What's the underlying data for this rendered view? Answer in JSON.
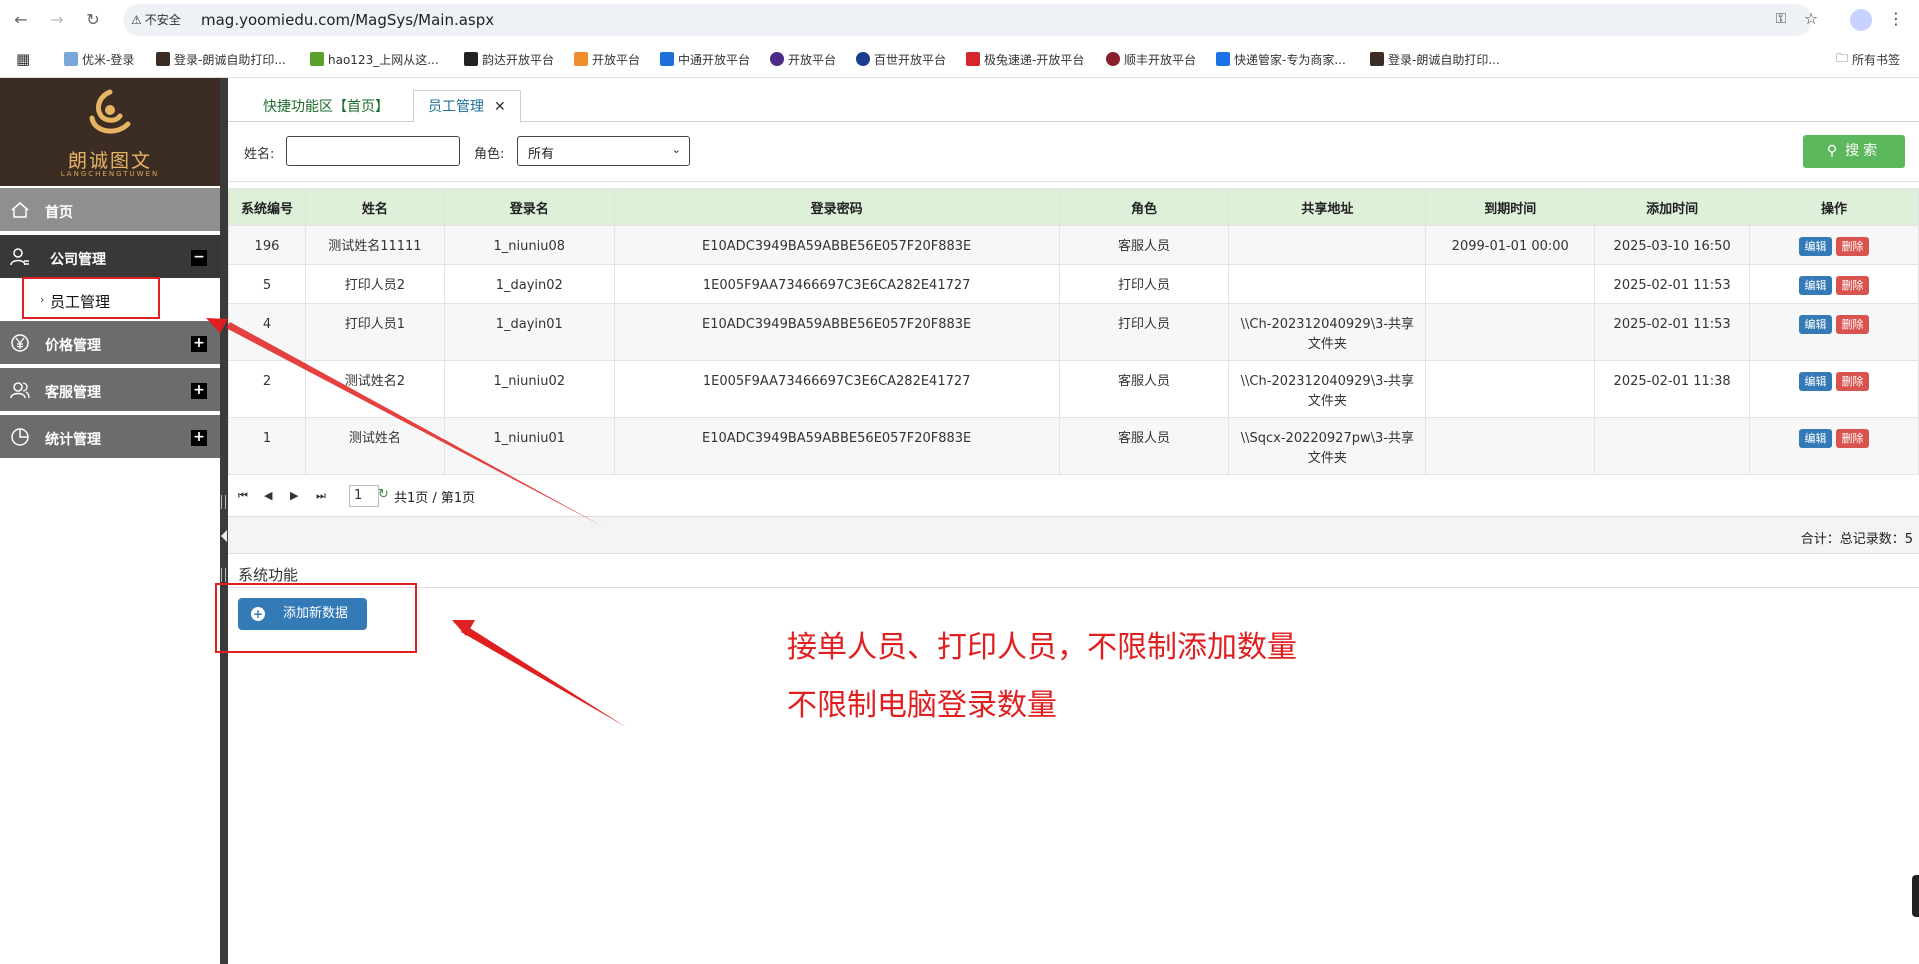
{
  "browser": {
    "security_label": "不安全",
    "url": "mag.yoomiedu.com/MagSys/Main.aspx"
  },
  "bookmarks": [
    {
      "label": "优米-登录",
      "color": "#7aa7d8"
    },
    {
      "label": "登录-朗诚自助打印...",
      "color": "#3b2d23"
    },
    {
      "label": "hao123_上网从这...",
      "color": "#5aa02c"
    },
    {
      "label": "韵达开放平台",
      "color": "#222222"
    },
    {
      "label": "开放平台",
      "color": "#f08c2a"
    },
    {
      "label": "中通开放平台",
      "color": "#1e6fd9"
    },
    {
      "label": "开放平台",
      "color": "#4b2a8a"
    },
    {
      "label": "百世开放平台",
      "color": "#1b3d8f"
    },
    {
      "label": "极兔速递-开放平台",
      "color": "#d6262c"
    },
    {
      "label": "顺丰开放平台",
      "color": "#8a1e2a"
    },
    {
      "label": "快递管家-专为商家...",
      "color": "#1a73e8"
    },
    {
      "label": "登录-朗诚自助打印...",
      "color": "#3b2d23"
    }
  ],
  "bookmarks_all": "所有书签",
  "logo": {
    "cn": "朗诚图文",
    "en": "LANGCHENGTUWEN"
  },
  "sidebar": {
    "home": "首页",
    "company": "公司管理",
    "company_toggle": "−",
    "sub_staff": "员工管理",
    "price": "价格管理",
    "service": "客服管理",
    "stats": "统计管理",
    "plus": "+"
  },
  "tabs": [
    {
      "label": "快捷功能区【首页】"
    },
    {
      "label": "员工管理",
      "close": "✕"
    }
  ],
  "search": {
    "name_label": "姓名:",
    "role_label": "角色:",
    "role_value": "所有",
    "button": "搜索"
  },
  "table": {
    "headers": [
      "系统编号",
      "姓名",
      "登录名",
      "登录密码",
      "角色",
      "共享地址",
      "到期时间",
      "添加时间",
      "操作"
    ],
    "rows": [
      {
        "id": "196",
        "name": "测试姓名11111",
        "login": "1_niuniu08",
        "pwd": "E10ADC3949BA59ABBE56E057F20F883E",
        "role": "客服人员",
        "share1": "",
        "share2": "",
        "expire": "2099-01-01 00:00",
        "added": "2025-03-10 16:50"
      },
      {
        "id": "5",
        "name": "打印人员2",
        "login": "1_dayin02",
        "pwd": "1E005F9AA73466697C3E6CA282E41727",
        "role": "打印人员",
        "share1": "",
        "share2": "",
        "expire": "",
        "added": "2025-02-01 11:53"
      },
      {
        "id": "4",
        "name": "打印人员1",
        "login": "1_dayin01",
        "pwd": "E10ADC3949BA59ABBE56E057F20F883E",
        "role": "打印人员",
        "share1": "\\\\Ch-202312040929\\3-共享",
        "share2": "文件夹",
        "expire": "",
        "added": "2025-02-01 11:53"
      },
      {
        "id": "2",
        "name": "测试姓名2",
        "login": "1_niuniu02",
        "pwd": "1E005F9AA73466697C3E6CA282E41727",
        "role": "客服人员",
        "share1": "\\\\Ch-202312040929\\3-共享",
        "share2": "文件夹",
        "expire": "",
        "added": "2025-02-01 11:38"
      },
      {
        "id": "1",
        "name": "测试姓名",
        "login": "1_niuniu01",
        "pwd": "E10ADC3949BA59ABBE56E057F20F883E",
        "role": "客服人员",
        "share1": "\\\\Sqcx-20220927pw\\3-共享",
        "share2": "文件夹",
        "expire": "",
        "added": ""
      }
    ],
    "edit_label": "编辑",
    "delete_label": "删除"
  },
  "pager": {
    "page_input": "1",
    "info": "共1页 / 第1页",
    "total": "合计：总记录数：5"
  },
  "system": {
    "title": "系统功能",
    "add_button": "添加新数据"
  },
  "annotation": {
    "line1": "接单人员、打印人员，不限制添加数量",
    "line2": "不限制电脑登录数量",
    "color": "#e02020"
  }
}
